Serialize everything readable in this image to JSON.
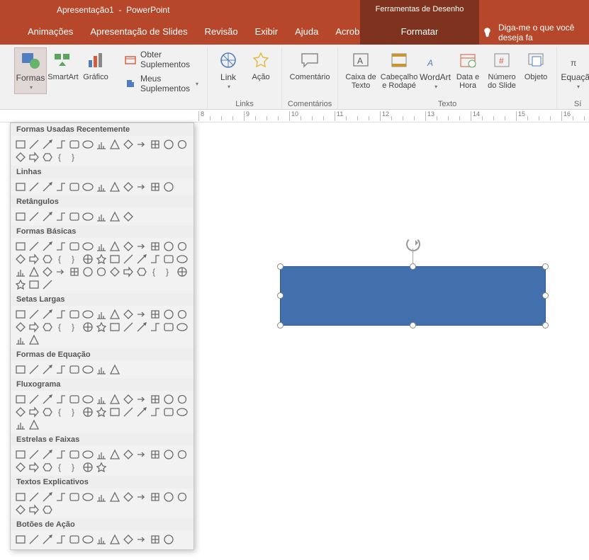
{
  "title": {
    "doc": "Apresentação1",
    "app": "PowerPoint",
    "tool_tab": "Ferramentas de Desenho"
  },
  "tabs": {
    "animacoes": "Animações",
    "apresentacao": "Apresentação de Slides",
    "revisao": "Revisão",
    "exibir": "Exibir",
    "ajuda": "Ajuda",
    "acrobat": "Acrobat",
    "formatar": "Formatar",
    "tell_me": "Diga-me o que você deseja fa"
  },
  "ribbon": {
    "formas": "Formas",
    "smartart": "SmartArt",
    "grafico": "Gráfico",
    "obter_supp": "Obter Suplementos",
    "meus_supp": "Meus Suplementos",
    "link": "Link",
    "acao": "Ação",
    "comentario": "Comentário",
    "caixa_texto": "Caixa de Texto",
    "cabecalho": "Cabeçalho e Rodapé",
    "wordart": "WordArt",
    "data_hora": "Data e Hora",
    "numero_slide": "Número do Slide",
    "objeto": "Objeto",
    "equacao": "Equação",
    "grp_links": "Links",
    "grp_coment": "Comentários",
    "grp_texto": "Texto",
    "grp_sim": "Sí"
  },
  "shape_menu": {
    "recent": "Formas Usadas Recentemente",
    "linhas": "Linhas",
    "retangulos": "Retângulos",
    "basicas": "Formas Básicas",
    "setas": "Setas Largas",
    "equacao": "Formas de Equação",
    "fluxo": "Fluxograma",
    "estrelas": "Estrelas e Faixas",
    "textos": "Textos Explicativos",
    "acao": "Botões de Ação"
  },
  "shape_counts": {
    "recent": 18,
    "linhas": 12,
    "retangulos": 9,
    "basicas": 42,
    "setas": 28,
    "equacao": 8,
    "fluxo": 28,
    "estrelas": 20,
    "textos": 16,
    "acao": 12
  },
  "ruler": {
    "start": 8,
    "end": 16
  },
  "chart_data": null
}
